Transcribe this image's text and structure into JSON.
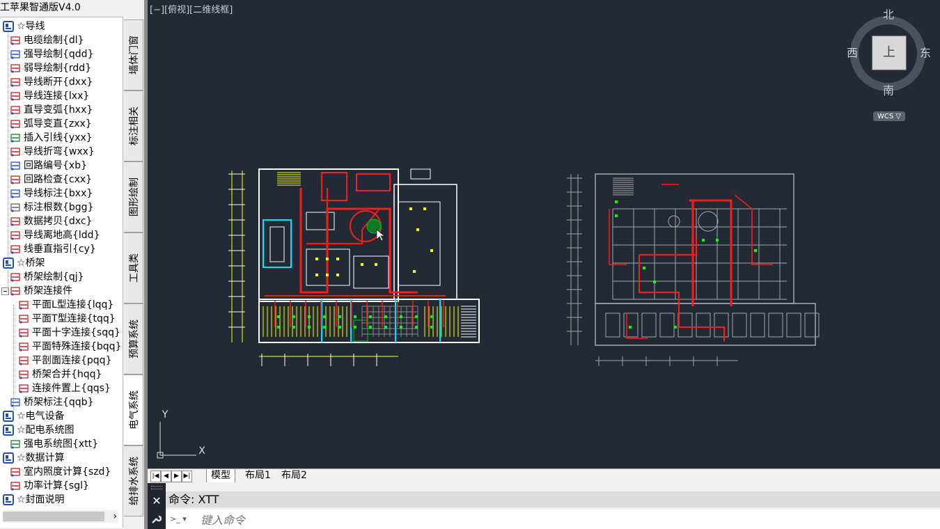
{
  "palette": {
    "title": "工苹果智通版V4.0",
    "tree": [
      {
        "label": "☆导线",
        "level": 0,
        "icon": "folder-icon",
        "color": "#1e4fa8"
      },
      {
        "label": "电缆绘制{dl}",
        "level": 1,
        "icon": "cable-icon",
        "color": "#c0202a"
      },
      {
        "label": "强导绘制{qdd}",
        "level": 1,
        "icon": "strong-wire-icon",
        "color": "#2a50c8"
      },
      {
        "label": "弱导绘制{rdd}",
        "level": 1,
        "icon": "weak-wire-icon",
        "color": "#c0202a"
      },
      {
        "label": "导线断开{dxx}",
        "level": 1,
        "icon": "wire-break-icon",
        "color": "#c0202a"
      },
      {
        "label": "导线连接{lxx}",
        "level": 1,
        "icon": "wire-connect-icon",
        "color": "#c0202a"
      },
      {
        "label": "直导变弧{hxx}",
        "level": 1,
        "icon": "straight-to-arc-icon",
        "color": "#c0202a"
      },
      {
        "label": "弧导变直{zxx}",
        "level": 1,
        "icon": "arc-to-straight-icon",
        "color": "#c0202a"
      },
      {
        "label": "插入引线{yxx}",
        "level": 1,
        "icon": "leader-icon",
        "color": "#208030"
      },
      {
        "label": "导线折弯{wxx}",
        "level": 1,
        "icon": "wire-bend-icon",
        "color": "#c0202a"
      },
      {
        "label": "回路编号{xb}",
        "level": 1,
        "icon": "circuit-number-icon",
        "color": "#2a50c8"
      },
      {
        "label": "回路检查{cxx}",
        "level": 1,
        "icon": "circuit-check-icon",
        "color": "#c0202a"
      },
      {
        "label": "导线标注{bxx}",
        "level": 1,
        "icon": "wire-annotation-icon",
        "color": "#2a50c8"
      },
      {
        "label": "标注根数{bgg}",
        "level": 1,
        "icon": "count-annotation-icon",
        "color": "#606060"
      },
      {
        "label": "数据拷贝{dxc}",
        "level": 1,
        "icon": "data-copy-icon",
        "color": "#c0202a"
      },
      {
        "label": "导线离地高{ldd}",
        "level": 1,
        "icon": "height-icon",
        "color": "#c0202a"
      },
      {
        "label": "线垂直指引{cy}",
        "level": 1,
        "icon": "vertical-leader-icon",
        "color": "#c0202a"
      },
      {
        "label": "☆桥架",
        "level": 0,
        "icon": "folder-icon",
        "color": "#1e4fa8"
      },
      {
        "label": "桥架绘制{qj}",
        "level": 1,
        "icon": "tray-draw-icon",
        "color": "#c0202a"
      },
      {
        "label": "桥架连接件",
        "level": 0,
        "icon": "tray-connector-icon",
        "color": "#c0202a",
        "expander": "minus"
      },
      {
        "label": "平面L型连接{lqq}",
        "level": 2,
        "icon": "l-connect-icon",
        "color": "#c0202a"
      },
      {
        "label": "平面T型连接{tqq}",
        "level": 2,
        "icon": "t-connect-icon",
        "color": "#c0202a"
      },
      {
        "label": "平面十字连接{sqq}",
        "level": 2,
        "icon": "cross-connect-icon",
        "color": "#c0202a"
      },
      {
        "label": "平面特殊连接{bqq}",
        "level": 2,
        "icon": "special-connect-icon",
        "color": "#c0202a"
      },
      {
        "label": "平剖面连接{pqq}",
        "level": 2,
        "icon": "section-connect-icon",
        "color": "#c0202a"
      },
      {
        "label": "桥架合并{hqq}",
        "level": 2,
        "icon": "tray-merge-icon",
        "color": "#c0202a"
      },
      {
        "label": "连接件置上{qqs}",
        "level": 2,
        "icon": "connector-up-icon",
        "color": "#c0202a"
      },
      {
        "label": "桥架标注{qqb}",
        "level": 1,
        "icon": "tray-annotation-icon",
        "color": "#2a50c8"
      },
      {
        "label": "☆电气设备",
        "level": 0,
        "icon": "folder-icon",
        "color": "#1e4fa8"
      },
      {
        "label": "☆配电系统图",
        "level": 0,
        "icon": "folder-icon",
        "color": "#1e4fa8"
      },
      {
        "label": "强电系统图{xtt}",
        "level": 1,
        "icon": "system-diagram-icon",
        "color": "#208030"
      },
      {
        "label": "☆数据计算",
        "level": 0,
        "icon": "folder-icon",
        "color": "#1e4fa8"
      },
      {
        "label": "室内照度计算{szd}",
        "level": 1,
        "icon": "illuminance-icon",
        "color": "#c0202a"
      },
      {
        "label": "功率计算{sgl}",
        "level": 1,
        "icon": "power-calc-icon",
        "color": "#c0202a"
      },
      {
        "label": "☆封面说明",
        "level": 0,
        "icon": "folder-icon",
        "color": "#1e4fa8"
      }
    ],
    "scroll_arrow": "›"
  },
  "tabs": [
    {
      "label": "墙体门窗",
      "active": false
    },
    {
      "label": "标注相关",
      "active": false
    },
    {
      "label": "图形绘制",
      "active": false
    },
    {
      "label": "工具类",
      "active": false
    },
    {
      "label": "预算系统",
      "active": false
    },
    {
      "label": "电气系统",
      "active": true
    },
    {
      "label": "给排水系统",
      "active": false
    }
  ],
  "viewport": {
    "label": "[−][俯视][二维线框]",
    "compass": {
      "north": "北",
      "south": "南",
      "east": "东",
      "west": "西",
      "center": "上",
      "wcs": "WCS ▽"
    },
    "ucs": {
      "x": "X",
      "y": "Y"
    }
  },
  "layout_tabs": [
    "模型",
    "布局1",
    "布局2"
  ],
  "nav_buttons": [
    "|◀",
    "◀",
    "▶",
    "▶|"
  ],
  "command": {
    "history": "命令: XTT",
    "placeholder": "键入命令",
    "close": "✕",
    "prompt_icon": ">_ ▾"
  },
  "colors": {
    "canvas_bg": "#222a35",
    "wire_red": "#ff1a1a",
    "wall_white": "#ffffff",
    "cyan": "#00e5ff",
    "yellow": "#ffff00",
    "green": "#00c800",
    "gray_plan": "#a8a8a8"
  }
}
